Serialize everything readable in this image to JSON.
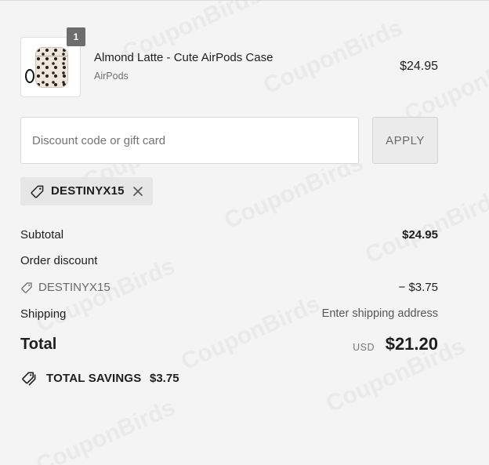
{
  "product": {
    "quantity": "1",
    "name": "Almond Latte - Cute AirPods Case",
    "variant": "AirPods",
    "price": "$24.95"
  },
  "discount_form": {
    "placeholder": "Discount code or gift card",
    "value": "",
    "apply_label": "APPLY"
  },
  "applied_code": {
    "code": "DESTINYX15",
    "icon": "tag-icon",
    "remove_icon": "close-icon"
  },
  "summary": {
    "subtotal_label": "Subtotal",
    "subtotal_value": "$24.95",
    "order_discount_label": "Order discount",
    "discount_code": "DESTINYX15",
    "discount_value": "− $3.75",
    "shipping_label": "Shipping",
    "shipping_value": "Enter shipping address",
    "total_label": "Total",
    "total_currency": "USD",
    "total_value": "$21.20"
  },
  "savings": {
    "label": "TOTAL SAVINGS",
    "amount": "$3.75",
    "icon": "tags-icon"
  },
  "watermark": {
    "text": "CouponBirds"
  },
  "colors": {
    "background": "#f4f4f4",
    "text": "#1e1e1e",
    "muted": "#6f6f6f",
    "badge": "#6d6d6d",
    "tag_background": "#e6e6e6"
  }
}
